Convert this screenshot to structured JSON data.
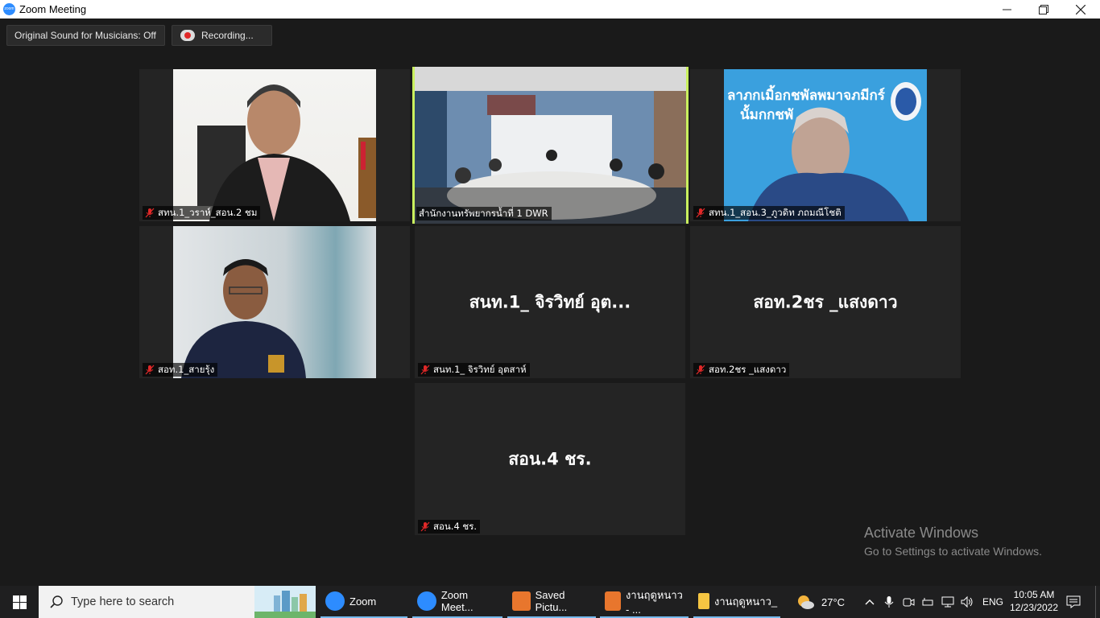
{
  "window": {
    "title": "Zoom Meeting",
    "app_icon_text": "zoom"
  },
  "toolbar": {
    "original_sound": "Original Sound for Musicians: Off",
    "recording": "Recording..."
  },
  "participants": [
    {
      "name": "สทน.1_วราห์_สอน.2 ชม",
      "video": true,
      "active": false
    },
    {
      "name": "สำนักงานทรัพยากรน้ำที่ 1 DWR",
      "video": true,
      "active": true
    },
    {
      "name": "สทน.1_สอน.3_ภูวดิท ภถมณีโชติ",
      "video": true,
      "active": false
    },
    {
      "name": "สอท.1_สายรุ้ง",
      "video": true,
      "active": false
    },
    {
      "name": "สนท.1_ จิรวิทย์ อุตสาห์",
      "display": "สนท.1_ จิรวิทย์ อุต...",
      "video": false,
      "active": false
    },
    {
      "name": "สอท.2ชร _แสงดาว",
      "display": "สอท.2ชร _แสงดาว",
      "video": false,
      "active": false
    },
    {
      "name": "สอน.4 ชร.",
      "display": "สอน.4 ชร.",
      "video": false,
      "active": false
    }
  ],
  "watermark": {
    "line1": "Activate Windows",
    "line2": "Go to Settings to activate Windows."
  },
  "taskbar": {
    "search_placeholder": "Type here to search",
    "apps": [
      {
        "label": "Zoom",
        "icon": "zoom-icon",
        "color": "#2d8cff"
      },
      {
        "label": "Zoom Meet...",
        "icon": "zoom-icon",
        "color": "#2d8cff"
      },
      {
        "label": "Saved Pictu...",
        "icon": "photo-viewer-icon",
        "color": "#e8762d"
      },
      {
        "label": "งานฤดูหนาว - ...",
        "icon": "photo-viewer-icon",
        "color": "#e8762d"
      },
      {
        "label": "งานฤดูหนาว_",
        "icon": "folder-icon",
        "color": "#f5c542"
      }
    ],
    "weather": "27°C",
    "language": "ENG",
    "time": "10:05 AM",
    "date": "12/23/2022"
  }
}
